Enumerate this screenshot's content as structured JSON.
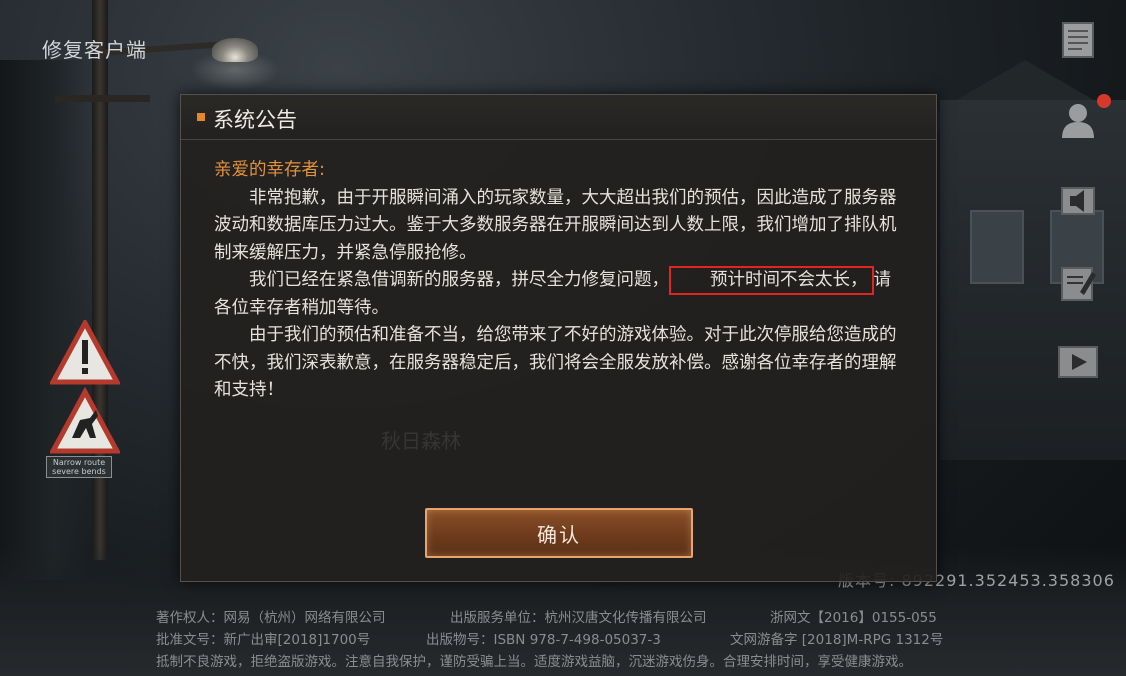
{
  "top_left": {
    "repair_label": "修复客户端"
  },
  "road_sign": {
    "text_line1": "Narrow route",
    "text_line2": "severe bends"
  },
  "side_buttons": [
    {
      "icon": "notice-icon"
    },
    {
      "icon": "user-icon",
      "has_notification": true
    },
    {
      "icon": "speaker-icon"
    },
    {
      "icon": "edit-icon"
    },
    {
      "icon": "video-icon"
    }
  ],
  "version": "版本号: 892291.352453.358306",
  "dialog": {
    "title": "系统公告",
    "greeting": "亲爱的幸存者:",
    "paragraph1": "非常抱歉，由于开服瞬间涌入的玩家数量，大大超出我们的预估，因此造成了服务器波动和数据库压力过大。鉴于大多数服务器在开服瞬间达到人数上限，我们增加了排队机制来缓解压力，并紧急停服抢修。",
    "paragraph2_before": "我们已经在紧急借调新的服务器，拼尽全力修复问题，",
    "paragraph2_highlight": "预计时间不会太长，",
    "paragraph2_after": "请各位幸存者稍加等待。",
    "paragraph3": "由于我们的预估和准备不当，给您带来了不好的游戏体验。对于此次停服给您造成的不快，我们深表歉意，在服务器稳定后，我们将会全服发放补偿。感谢各位幸存者的理解和支持！",
    "confirm_label": "确认",
    "background_text": "秋日森林",
    "accent_color": "#e0923c",
    "highlight_color": "#e0261f"
  },
  "footer": {
    "copyright": "著作权人：网易（杭州）网络有限公司",
    "publisher": "出版服务单位：杭州汉唐文化传播有限公司",
    "zhejiang": "浙网文【2016】0155-055",
    "approval": "批准文号：新广出审[2018]1700号",
    "isbn": "出版物号：ISBN 978-7-498-05037-3",
    "culture": "文网游备字 [2018]M-RPG 1312号",
    "health": "抵制不良游戏，拒绝盗版游戏。注意自我保护，谨防受骗上当。适度游戏益脑，沉迷游戏伤身。合理安排时间，享受健康游戏。"
  }
}
